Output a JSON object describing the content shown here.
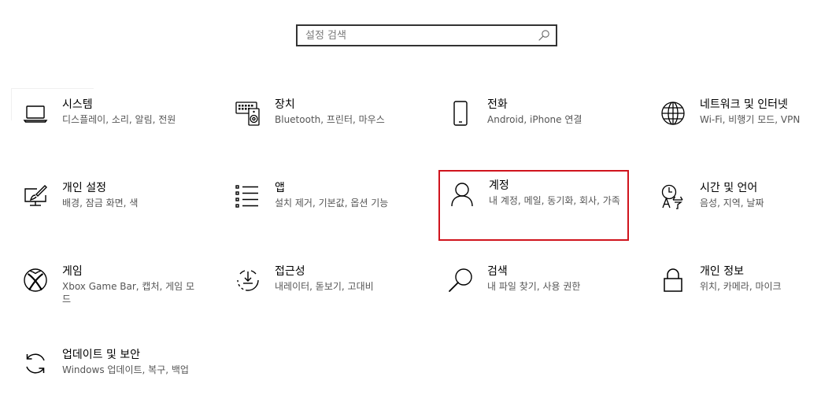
{
  "search": {
    "placeholder": "설정 검색",
    "icon": "search-icon"
  },
  "accent_color": "#d0141d",
  "tiles": [
    {
      "title": "시스템",
      "subtitle": "디스플레이, 소리, 알림, 전원",
      "icon": "laptop-icon"
    },
    {
      "title": "장치",
      "subtitle": "Bluetooth, 프린터, 마우스",
      "icon": "keyboard-speaker-icon"
    },
    {
      "title": "전화",
      "subtitle": "Android, iPhone 연결",
      "icon": "phone-icon"
    },
    {
      "title": "네트워크 및 인터넷",
      "subtitle": "Wi-Fi, 비행기 모드, VPN",
      "icon": "globe-icon"
    },
    {
      "title": "개인 설정",
      "subtitle": "배경, 잠금 화면, 색",
      "icon": "paint-monitor-icon"
    },
    {
      "title": "앱",
      "subtitle": "설치 제거, 기본값, 옵션 기능",
      "icon": "apps-list-icon"
    },
    {
      "title": "계정",
      "subtitle": "내 계정, 메일, 동기화, 회사, 가족",
      "icon": "person-icon"
    },
    {
      "title": "시간 및 언어",
      "subtitle": "음성, 지역, 날짜",
      "icon": "time-language-icon"
    },
    {
      "title": "게임",
      "subtitle": "Xbox Game Bar, 캡처, 게임 모드",
      "icon": "xbox-icon"
    },
    {
      "title": "접근성",
      "subtitle": "내레이터, 돋보기, 고대비",
      "icon": "ease-of-access-icon"
    },
    {
      "title": "검색",
      "subtitle": "내 파일 찾기, 사용 권한",
      "icon": "magnifier-icon"
    },
    {
      "title": "개인 정보",
      "subtitle": "위치, 카메라, 마이크",
      "icon": "lock-icon"
    },
    {
      "title": "업데이트 및 보안",
      "subtitle": "Windows 업데이트, 복구, 백업",
      "icon": "sync-icon"
    }
  ]
}
